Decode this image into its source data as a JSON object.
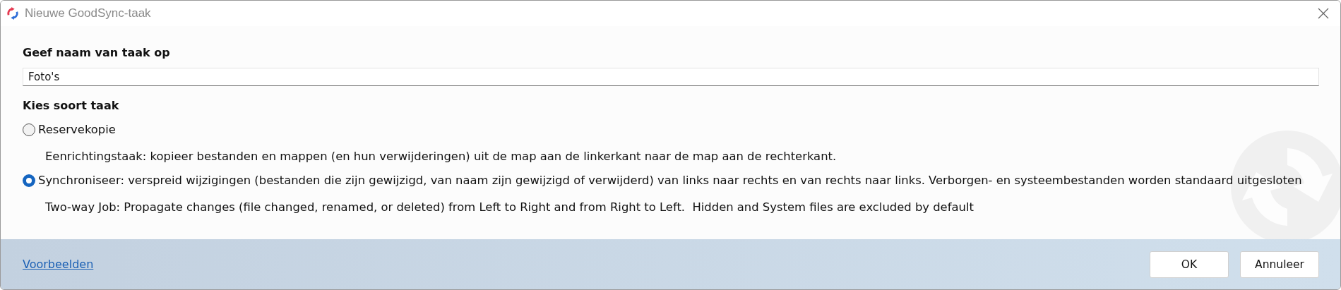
{
  "window": {
    "title": "Nieuwe GoodSync-taak"
  },
  "name_section": {
    "heading": "Geef naam van taak op",
    "field": {
      "value": "Foto's"
    }
  },
  "type_section": {
    "heading": "Kies soort taak",
    "options": [
      {
        "label": "Reservekopie",
        "description": "Eenrichtingstaak: kopieer bestanden en mappen (en hun verwijderingen) uit de map aan de linkerkant naar de map aan de rechterkant.",
        "selected": false
      },
      {
        "label": "Synchroniseer: verspreid wijzigingen (bestanden die zijn gewijzigd, van naam zijn gewijzigd of verwijderd) van links naar rechts en van rechts naar links. Verborgen- en systeembestanden worden standaard uitgesloten",
        "description": "Two-way Job: Propagate changes (file changed, renamed, or deleted) from Left to Right and from Right to Left.  Hidden and System files are excluded by default",
        "selected": true
      }
    ]
  },
  "footer": {
    "link": "Voorbeelden",
    "buttons": [
      "OK",
      "Annuleer"
    ]
  }
}
